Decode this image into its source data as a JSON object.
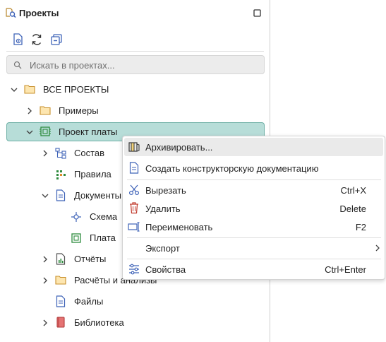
{
  "panel": {
    "title": "Проекты"
  },
  "search": {
    "placeholder": "Искать в проектах..."
  },
  "tree": {
    "root": "ВСЕ ПРОЕКТЫ",
    "examples": "Примеры",
    "project": "Проект платы",
    "composition": "Состав",
    "rules": "Правила",
    "documents": "Документы",
    "schematic": "Схема",
    "board": "Плата",
    "reports": "Отчёты",
    "analyses": "Расчёты и анализы",
    "files": "Файлы",
    "library": "Библиотека"
  },
  "context_menu": {
    "items": [
      {
        "label": "Архивировать...",
        "shortcut": "",
        "icon": "archive-icon"
      },
      {
        "label": "Создать конструкторскую документацию",
        "shortcut": "",
        "icon": "document-icon"
      },
      {
        "label": "Вырезать",
        "shortcut": "Ctrl+X",
        "icon": "scissors-icon"
      },
      {
        "label": "Удалить",
        "shortcut": "Delete",
        "icon": "trash-icon"
      },
      {
        "label": "Переименовать",
        "shortcut": "F2",
        "icon": "rename-icon"
      },
      {
        "label": "Экспорт",
        "shortcut": "",
        "icon": "submenu-chevron-icon"
      },
      {
        "label": "Свойства",
        "shortcut": "Ctrl+Enter",
        "icon": "settings-sliders-icon"
      }
    ]
  },
  "colors": {
    "selection": "#b7ddd8",
    "selection_border": "#6fb0a6",
    "folder": "#e8b54a",
    "accent_blue": "#3f63b8",
    "accent_green": "#2e8b3e",
    "delete_red": "#c0392b"
  }
}
